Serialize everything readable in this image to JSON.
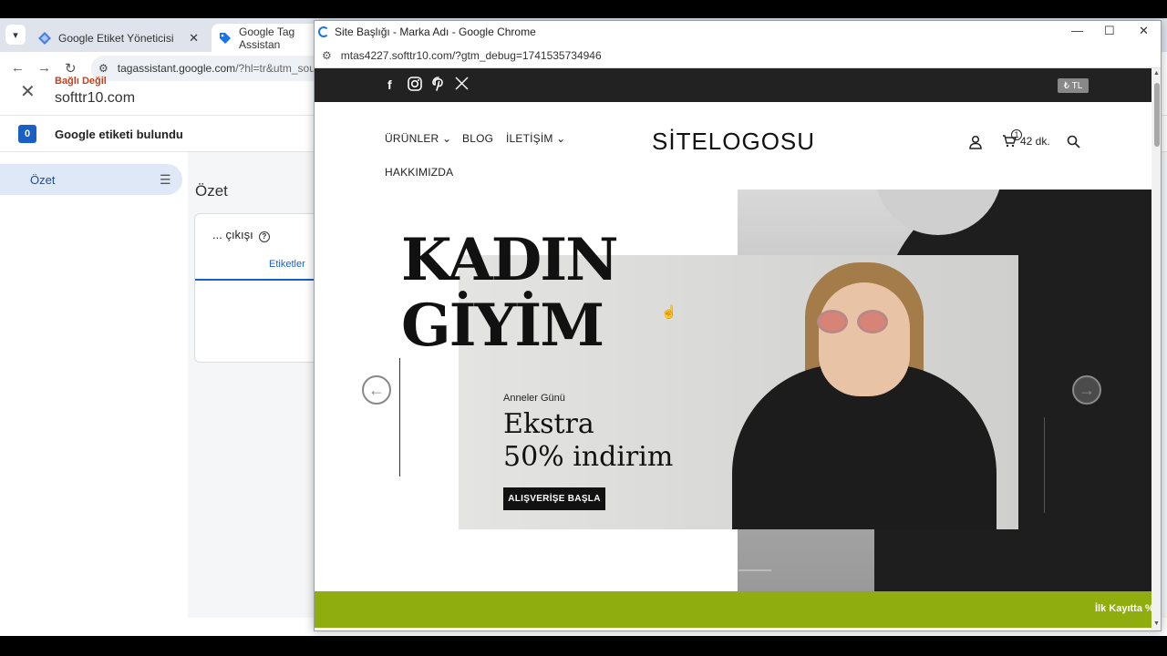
{
  "background_browser": {
    "tabs": [
      {
        "label": "Google Etiket Yöneticisi"
      },
      {
        "label": "Google Tag Assistan"
      }
    ],
    "url": "tagassistant.google.com",
    "url_path": "/?hl=tr&utm_sou"
  },
  "tag_assistant": {
    "connection_status": "Bağlı Değil",
    "domain": "softtr10.com",
    "found_count": "0",
    "found_label": "Google etiketi bulundu",
    "sidebar_item": "Özet",
    "page_title": "Özet",
    "card_title": "... çıkışı",
    "card_tab": "Etiketler"
  },
  "popup_window": {
    "title": "Site Başlığı - Marka Adı - Google Chrome",
    "url": "mtas4227.softtr10.com/?gtm_debug=1741535734946"
  },
  "site": {
    "currency": "₺ TL",
    "nav": {
      "products": "ÜRÜNLER",
      "blog": "BLOG",
      "contact": "İLETİŞİM",
      "about": "HAKKIMIZDA"
    },
    "logo": "SİTELOGOSU",
    "cart_count": "1",
    "cart_text": "42 dk.",
    "hero": {
      "headline_line1": "KADIN",
      "headline_line2": "GİYİM",
      "subtitle": "Anneler Günü",
      "promo_line1": "Ekstra",
      "promo_line2": "50% indirim",
      "cta": "ALIŞVERİŞE BAŞLA"
    },
    "banner_text": "İlk Kayıtta %"
  },
  "colors": {
    "topbar": "#222222",
    "greenbar": "#8fad0e",
    "ta_status": "#c5401f",
    "ta_accent": "#1a5fc4"
  }
}
